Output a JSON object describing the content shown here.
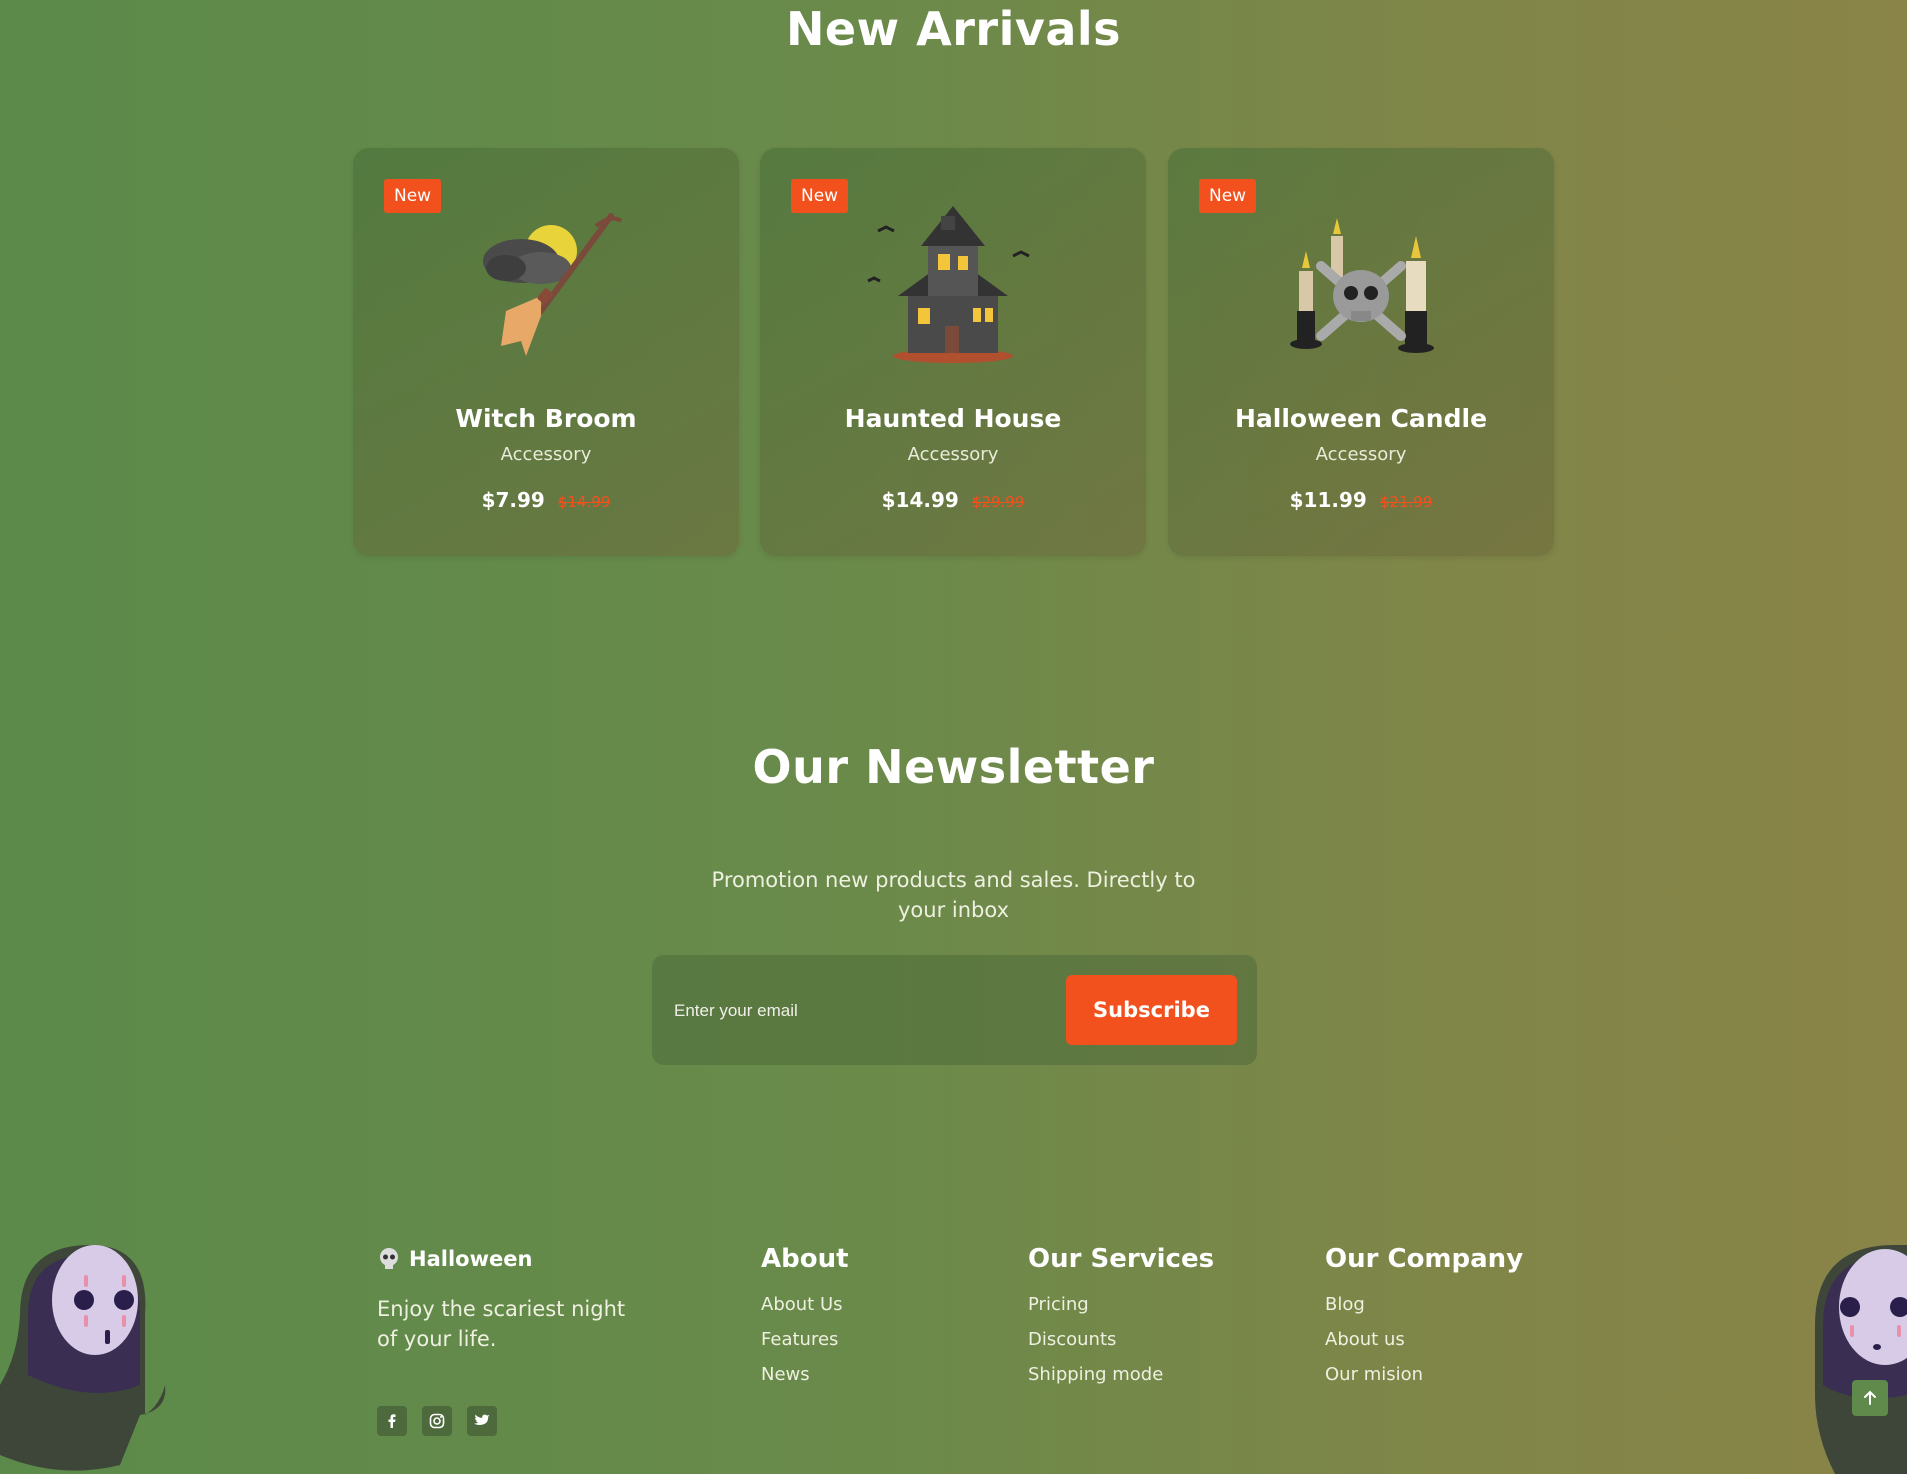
{
  "arrivals": {
    "title": "New Arrivals",
    "products": [
      {
        "badge": "New",
        "name": "Witch Broom",
        "category": "Accessory",
        "price": "$7.99",
        "old_price": "$14.99",
        "image": "witch-broom-icon"
      },
      {
        "badge": "New",
        "name": "Haunted House",
        "category": "Accessory",
        "price": "$14.99",
        "old_price": "$29.99",
        "image": "haunted-house-icon"
      },
      {
        "badge": "New",
        "name": "Halloween Candle",
        "category": "Accessory",
        "price": "$11.99",
        "old_price": "$21.99",
        "image": "halloween-candle-icon"
      }
    ]
  },
  "newsletter": {
    "title": "Our Newsletter",
    "text": "Promotion new products and sales. Directly to your inbox",
    "email_placeholder": "Enter your email",
    "subscribe_label": "Subscribe"
  },
  "footer": {
    "brand": "Halloween",
    "tagline": "Enjoy the scariest night of your life.",
    "social": [
      "facebook-icon",
      "instagram-icon",
      "twitter-icon"
    ],
    "columns": [
      {
        "title": "About",
        "links": [
          "About Us",
          "Features",
          "News"
        ]
      },
      {
        "title": "Our Services",
        "links": [
          "Pricing",
          "Discounts",
          "Shipping mode"
        ]
      },
      {
        "title": "Our Company",
        "links": [
          "Blog",
          "About us",
          "Our mision"
        ]
      }
    ]
  },
  "colors": {
    "accent": "#f2511e",
    "background_start": "#5b8a4a",
    "background_end": "#8a8448"
  }
}
